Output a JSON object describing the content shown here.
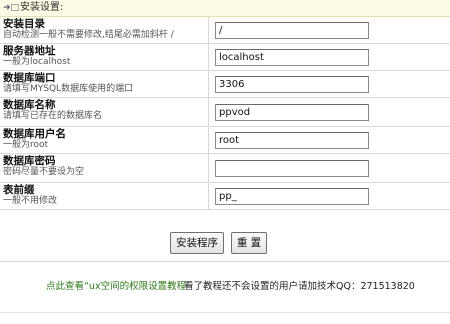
{
  "header": {
    "icon": "arrow-icon",
    "title": "安装设置:"
  },
  "rows": [
    {
      "label": "安装目录",
      "hint": "自动检测一般不需要修改,结尾必需加斜杆 /",
      "value": "/"
    },
    {
      "label": "服务器地址",
      "hint": "一般为localhost",
      "value": "localhost"
    },
    {
      "label": "数据库端口",
      "hint": "请填写MYSQL数据库使用的端口",
      "value": "3306"
    },
    {
      "label": "数据库名称",
      "hint": "请填写已存在的数据库名",
      "value": "ppvod"
    },
    {
      "label": "数据库用户名",
      "hint": "一般为root",
      "value": "root"
    },
    {
      "label": "数据库密码",
      "hint": "密码尽量不要设为空",
      "value": ""
    },
    {
      "label": "表前缀",
      "hint": "一般不用修改",
      "value": "pp_"
    }
  ],
  "buttons": {
    "install": "安装程序",
    "reset": "重 置"
  },
  "footer": {
    "help_link": "点此查看“ux空间的权限设置教程",
    "support": "看了教程还不会设置的用户请加技术QQ：271513820"
  },
  "colors": {
    "header_bg": "#fdfbe3",
    "link_green": "#2f7a1c",
    "border": "#d9d9d9"
  }
}
